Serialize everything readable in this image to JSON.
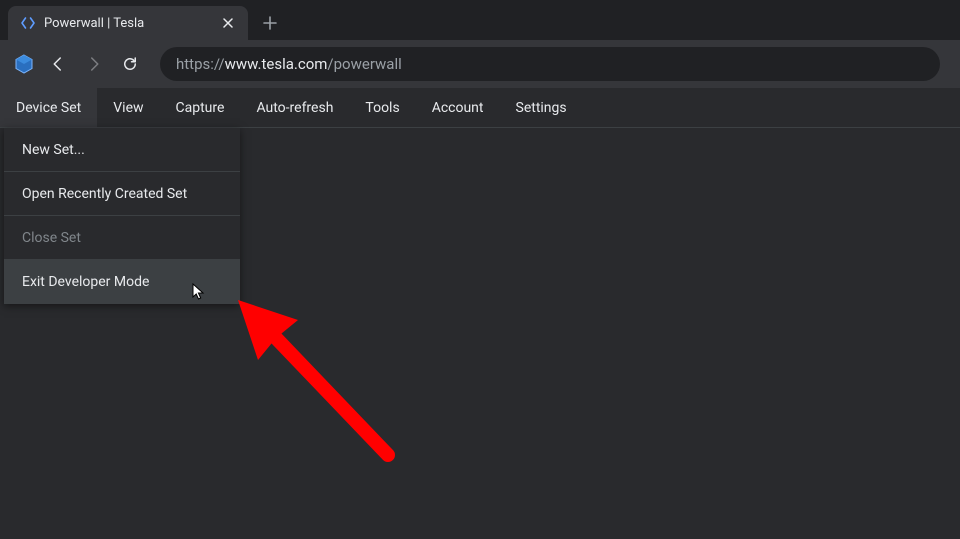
{
  "tab": {
    "title": "Powerwall | Tesla"
  },
  "address": {
    "proto": "https://",
    "host": "www.tesla.com",
    "path": "/powerwall"
  },
  "menu": {
    "items": [
      "Device Set",
      "View",
      "Capture",
      "Auto-refresh",
      "Tools",
      "Account",
      "Settings"
    ],
    "activeIndex": 0
  },
  "dropdown": {
    "items": [
      {
        "label": "New Set...",
        "disabled": false
      },
      {
        "label": "Open Recently Created Set",
        "disabled": false
      },
      {
        "label": "Close Set",
        "disabled": true
      },
      {
        "label": "Exit Developer Mode",
        "disabled": false,
        "hover": true
      }
    ]
  }
}
